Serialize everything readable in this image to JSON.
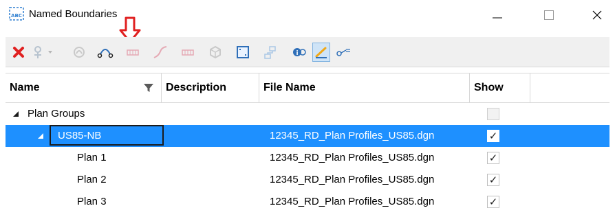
{
  "window": {
    "title": "Named Boundaries",
    "icon": "named-boundaries-icon"
  },
  "toolbar": {
    "buttons": [
      {
        "name": "delete-icon",
        "color": "#e02020"
      },
      {
        "name": "select-boundary-icon",
        "state": "disabled"
      },
      {
        "name": "dropdown-arrow-icon",
        "state": "disabled"
      },
      {
        "name": "civil-model-icon",
        "state": "disabled"
      },
      {
        "name": "group-boundaries-icon",
        "state": "enabled"
      },
      {
        "name": "grid-icon",
        "state": "disabled"
      },
      {
        "name": "profile-icon",
        "state": "disabled"
      },
      {
        "name": "grid-icon",
        "state": "disabled"
      },
      {
        "name": "3d-model-icon",
        "state": "disabled"
      },
      {
        "name": "fit-view-icon",
        "state": "enabled"
      },
      {
        "name": "hierarchy-icon",
        "state": "disabled"
      },
      {
        "name": "info-icon",
        "state": "enabled"
      },
      {
        "name": "draw-icon",
        "state": "active"
      },
      {
        "name": "key-settings-icon",
        "state": "enabled"
      }
    ]
  },
  "annotation": {
    "arrow_color": "#e02020"
  },
  "table": {
    "columns": [
      "Name",
      "Description",
      "File Name",
      "Show"
    ],
    "rows": [
      {
        "name": "Plan Groups",
        "level": 0,
        "expanded": true,
        "description": "",
        "file": "",
        "show": false,
        "show_disabled": true,
        "selected": false
      },
      {
        "name": "US85-NB",
        "level": 1,
        "expanded": true,
        "description": "",
        "file": "12345_RD_Plan Profiles_US85.dgn",
        "show": true,
        "show_disabled": false,
        "selected": true
      },
      {
        "name": "Plan 1",
        "level": 2,
        "expanded": false,
        "description": "",
        "file": "12345_RD_Plan Profiles_US85.dgn",
        "show": true,
        "show_disabled": false,
        "selected": false
      },
      {
        "name": "Plan 2",
        "level": 2,
        "expanded": false,
        "description": "",
        "file": "12345_RD_Plan Profiles_US85.dgn",
        "show": true,
        "show_disabled": false,
        "selected": false
      },
      {
        "name": "Plan 3",
        "level": 2,
        "expanded": false,
        "description": "",
        "file": "12345_RD_Plan Profiles_US85.dgn",
        "show": true,
        "show_disabled": false,
        "selected": false
      }
    ]
  },
  "colors": {
    "selection": "#1e90ff"
  }
}
